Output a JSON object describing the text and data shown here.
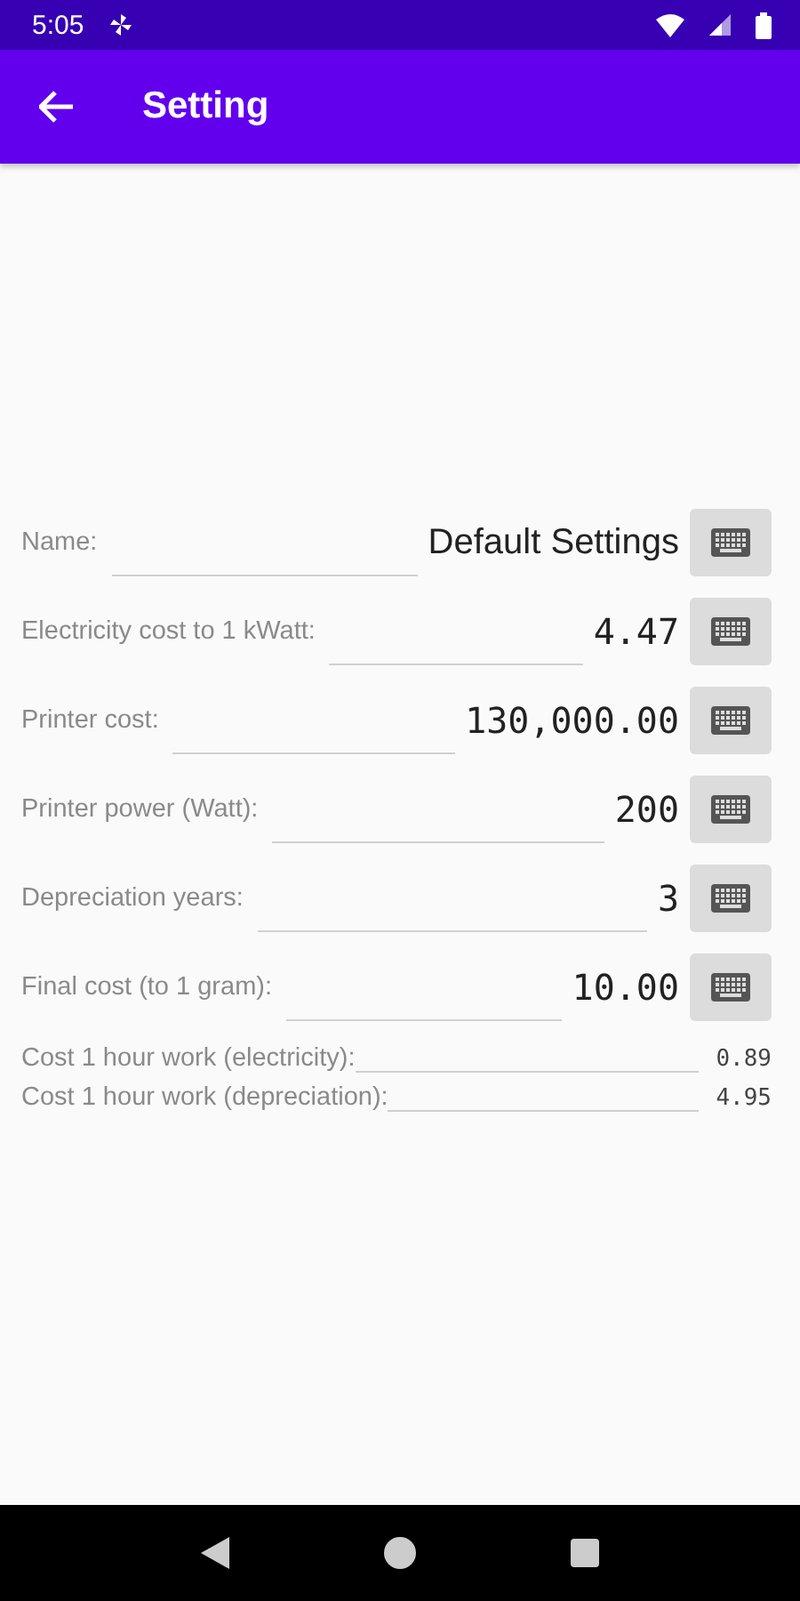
{
  "status_bar": {
    "time": "5:05"
  },
  "app_bar": {
    "title": "Setting"
  },
  "settings": [
    {
      "label": "Name:",
      "value": "Default Settings",
      "kind": "text"
    },
    {
      "label": "Electricity cost to 1 kWatt:",
      "value": "4.47",
      "kind": "number"
    },
    {
      "label": "Printer cost:",
      "value": "130,000.00",
      "kind": "number"
    },
    {
      "label": "Printer power (Watt):",
      "value": "200",
      "kind": "number"
    },
    {
      "label": "Depreciation years:",
      "value": "3",
      "kind": "number"
    },
    {
      "label": "Final cost (to 1 gram):",
      "value": "10.00",
      "kind": "number"
    }
  ],
  "results": [
    {
      "label": "Cost 1 hour work (electricity):",
      "value": "0.89"
    },
    {
      "label": "Cost 1 hour work (depreciation):",
      "value": "4.95"
    }
  ]
}
